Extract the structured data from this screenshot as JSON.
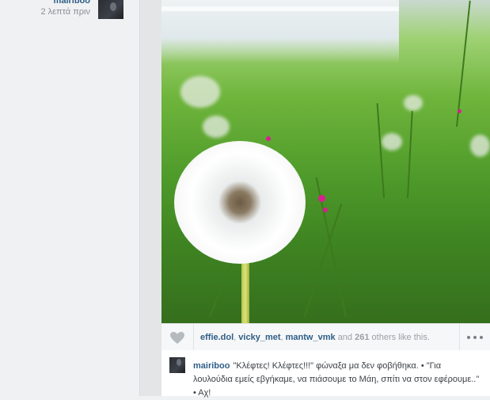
{
  "author": {
    "username": "mairiboo",
    "timestamp": "2 λεπτά πριν"
  },
  "likes": {
    "users": [
      "effie.dol",
      "vicky_met",
      "mantw_vmk"
    ],
    "separator": ", ",
    "and_text": "and",
    "others_count": "261",
    "others_text": "others like this."
  },
  "caption": {
    "username": "mairiboo",
    "text": "\"Κλέφτες! Κλέφτες!!!\" φώναξα μα δεν φοβήθηκα. • \"Για λουλούδια εμείς εβγήκαμε, να πιάσουμε το Μάη, σπίτι να στον εφέρουμε..\" • Αχ!"
  },
  "icons": {
    "like": "heart-icon",
    "more": "more-dots-icon"
  },
  "colors": {
    "username": "#2e5e86",
    "muted": "#9aa0a6",
    "background": "#f0f1f2"
  }
}
